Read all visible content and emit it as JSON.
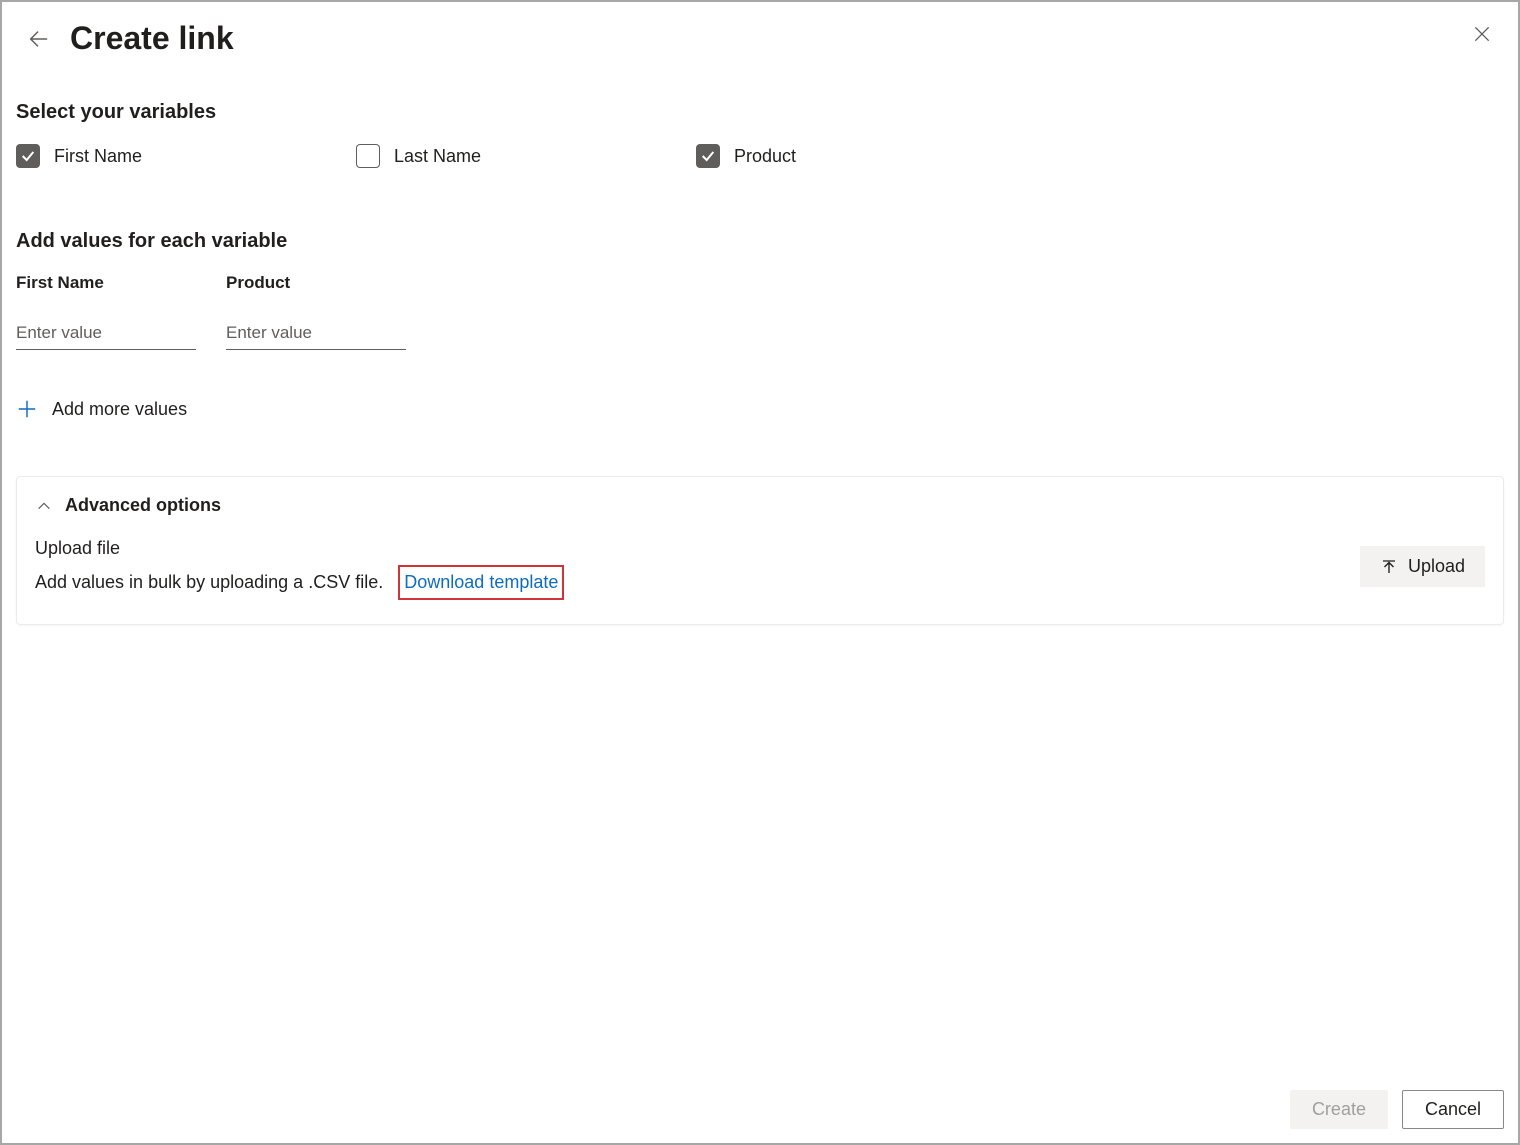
{
  "header": {
    "title": "Create link"
  },
  "select_variables": {
    "heading": "Select your variables",
    "items": [
      {
        "label": "First Name",
        "checked": true
      },
      {
        "label": "Last Name",
        "checked": false
      },
      {
        "label": "Product",
        "checked": true
      }
    ]
  },
  "add_values": {
    "heading": "Add values for each variable",
    "columns": [
      {
        "label": "First Name",
        "placeholder": "Enter value",
        "value": ""
      },
      {
        "label": "Product",
        "placeholder": "Enter value",
        "value": ""
      }
    ],
    "add_more_label": "Add more values"
  },
  "advanced": {
    "heading": "Advanced options",
    "upload_label": "Upload file",
    "upload_desc": "Add values in bulk by uploading a .CSV file.",
    "download_template_label": "Download template",
    "upload_button": "Upload"
  },
  "footer": {
    "create_label": "Create",
    "cancel_label": "Cancel"
  }
}
